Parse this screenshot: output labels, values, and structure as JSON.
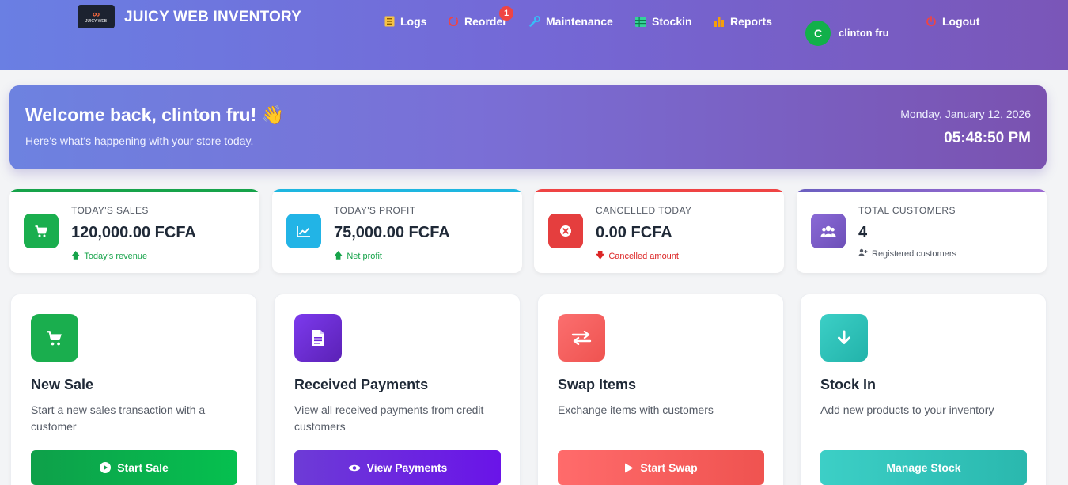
{
  "header": {
    "brand": "JUICY WEB INVENTORY",
    "logo_text": "JUICY WEB",
    "nav": [
      {
        "label": "Logs",
        "icon": "list-icon"
      },
      {
        "label": "Reorder",
        "icon": "reorder-icon"
      },
      {
        "label": "Maintenance",
        "icon": "wrench-icon"
      },
      {
        "label": "Stockin",
        "icon": "table-icon"
      },
      {
        "label": "Reports",
        "icon": "bar-chart-icon"
      }
    ],
    "reorder_badge": "1",
    "user_initial": "C",
    "user_name": "clinton fru",
    "logout_label": "Logout"
  },
  "welcome": {
    "title": "Welcome back, clinton fru! 👋",
    "subtitle": "Here's what's happening with your store today.",
    "date": "Monday, January 12, 2026",
    "time": "05:48:50 PM"
  },
  "stats": [
    {
      "label": "TODAY'S SALES",
      "value": "120,000.00 FCFA",
      "note": "Today's revenue",
      "accent": "#16a34a"
    },
    {
      "label": "TODAY'S PROFIT",
      "value": "75,000.00 FCFA",
      "note": "Net profit",
      "accent": "#1eb6e0"
    },
    {
      "label": "CANCELLED TODAY",
      "value": "0.00 FCFA",
      "note": "Cancelled amount",
      "accent": "#ef4444"
    },
    {
      "label": "TOTAL CUSTOMERS",
      "value": "4",
      "note": "Registered customers",
      "accent": "#7c5cc4"
    }
  ],
  "actions": [
    {
      "title": "New Sale",
      "desc": "Start a new sales transaction with a customer",
      "button": "Start Sale"
    },
    {
      "title": "Received Payments",
      "desc": "View all received payments from credit customers",
      "button": "View Payments"
    },
    {
      "title": "Swap Items",
      "desc": "Exchange items with customers",
      "button": "Start Swap"
    },
    {
      "title": "Stock In",
      "desc": "Add new products to your inventory",
      "button": "Manage Stock"
    }
  ]
}
